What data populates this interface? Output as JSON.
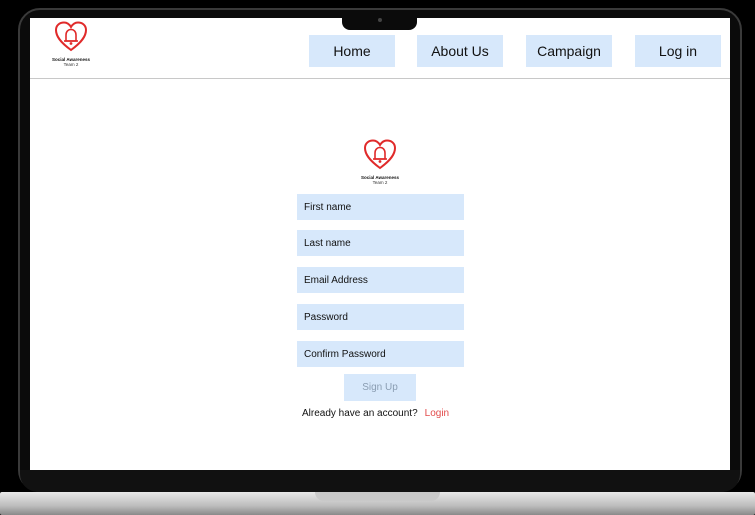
{
  "brand": {
    "name": "Social Awareness",
    "team": "Team 2",
    "accent_color": "#e02a2a",
    "icon": "heart-bell-icon"
  },
  "nav": {
    "items": [
      {
        "label": "Home"
      },
      {
        "label": "About Us"
      },
      {
        "label": "Campaign"
      },
      {
        "label": "Log in"
      }
    ],
    "button_color": "#d7e8fb"
  },
  "form": {
    "fields": [
      {
        "placeholder": "First name"
      },
      {
        "placeholder": "Last name"
      },
      {
        "placeholder": "Email Address"
      },
      {
        "placeholder": "Password"
      },
      {
        "placeholder": "Confirm Password"
      }
    ],
    "submit_label": "Sign Up",
    "already_text": "Already have an account?",
    "login_link": "Login",
    "link_color": "#e24b4b"
  }
}
